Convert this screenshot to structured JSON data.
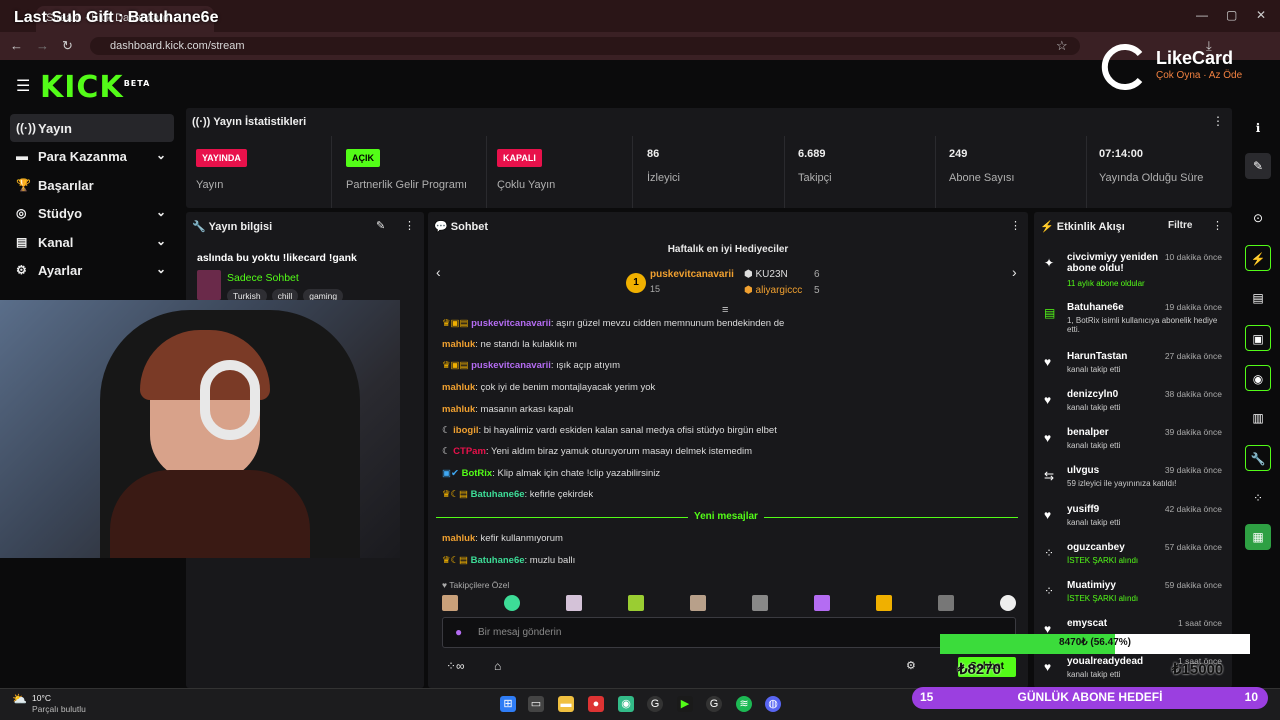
{
  "overlay": {
    "title": "Last Sub Gift : Batuhane6e"
  },
  "browser": {
    "tab_label": "Stream · Kick Dashboard",
    "url": "dashboard.kick.com/stream"
  },
  "brand": {
    "logo": "KICK",
    "beta": "BETA",
    "likecard": "LikeCard",
    "likecard_tag": "Çok Oyna · Az Öde",
    "accent": "#53fc18"
  },
  "sidebar": {
    "items": [
      {
        "label": "Yayın",
        "icon": "broadcast-icon"
      },
      {
        "label": "Para Kazanma",
        "icon": "money-icon"
      },
      {
        "label": "Başarılar",
        "icon": "trophy-icon"
      },
      {
        "label": "Stüdyo",
        "icon": "studio-icon"
      },
      {
        "label": "Kanal",
        "icon": "channel-icon"
      },
      {
        "label": "Ayarlar",
        "icon": "gear-icon"
      }
    ]
  },
  "stats": {
    "header": "Yayın İstatistikleri",
    "cells": [
      {
        "badge": "YAYINDA",
        "label": "Yayın",
        "color": "#e8114b"
      },
      {
        "badge": "AÇIK",
        "label": "Partnerlik Gelir Programı",
        "color": "#53fc18"
      },
      {
        "badge": "KAPALI",
        "label": "Çoklu Yayın",
        "color": "#e8114b"
      },
      {
        "value": "86",
        "label": "İzleyici"
      },
      {
        "value": "6.689",
        "label": "Takipçi"
      },
      {
        "value": "249",
        "label": "Abone Sayısı"
      },
      {
        "value": "07:14:00",
        "label": "Yayında Olduğu Süre"
      }
    ]
  },
  "info": {
    "header": "Yayın bilgisi",
    "title": "aslında bu yoktu !likecard !gank",
    "category": "Sadece Sohbet",
    "tags": [
      "Turkish",
      "chill",
      "gaming"
    ]
  },
  "chat": {
    "header": "Sohbet",
    "top_gifters_title": "Haftalık en iyi Hediyeciler",
    "gifters": [
      {
        "name": "puskevitcanavarii",
        "count": "15",
        "rank": "1"
      },
      {
        "name": "KU23N",
        "count": "6"
      },
      {
        "name": "aliyargiccc",
        "count": "5"
      }
    ],
    "messages": [
      {
        "user": "puskevitcanavarii",
        "text": ": aşırı güzel mevzu cidden memnunum bendekinden de",
        "color": "#b46cf2"
      },
      {
        "user": "mahluk",
        "text": ": ne standı la kulaklık mı",
        "color": "#f0a030"
      },
      {
        "user": "puskevitcanavarii",
        "text": ": ışık açıp atıyım",
        "color": "#b46cf2"
      },
      {
        "user": "mahluk",
        "text": ": çok iyi de benim montajlayacak yerim yok",
        "color": "#f0a030"
      },
      {
        "user": "mahluk",
        "text": ": masanın arkası kapalı",
        "color": "#f0a030"
      },
      {
        "user": "ibogil",
        "text": ": bi hayalimiz vardı eskiden kalan sanal medya ofisi stüdyo birgün elbet",
        "color": "#f0a030"
      },
      {
        "user": "CTPam",
        "text": ": Yeni aldım biraz yamuk oturuyorum masayı delmek istemedim",
        "color": "#e8114b"
      },
      {
        "user": "BotRix",
        "text": ": Klip almak için chate !clip yazabilirsiniz",
        "color": "#53fc18"
      },
      {
        "user": "Batuhane6e",
        "text": ": kefirle çekirdek",
        "color": "#3ddc97"
      }
    ],
    "new_messages": "Yeni mesajlar",
    "messages2": [
      {
        "user": "mahluk",
        "text": ": kefir kullanmıyorum",
        "color": "#f0a030"
      },
      {
        "user": "Batuhane6e",
        "text": ": muzlu ballı",
        "color": "#3ddc97"
      }
    ],
    "followers_only": "Takipçilere Özel",
    "input_placeholder": "Bir mesaj gönderin",
    "send_label": "Sohbet"
  },
  "events": {
    "header": "Etkinlik Akışı",
    "filter": "Filtre",
    "items": [
      {
        "name": "civcivmiyy yeniden abone oldu!",
        "time": "10 dakika önce",
        "desc": "11 aylık abone oldular",
        "icon": "sparkle-icon"
      },
      {
        "name": "Batuhane6e",
        "time": "19 dakika önce",
        "desc": "1, BotRix isimli kullanıcıya abonelik hediye etti.",
        "icon": "gift-icon"
      },
      {
        "name": "HarunTastan",
        "time": "27 dakika önce",
        "desc": "kanalı takip etti",
        "icon": "heart-icon"
      },
      {
        "name": "denizcyln0",
        "time": "38 dakika önce",
        "desc": "kanalı takip etti",
        "icon": "heart-icon"
      },
      {
        "name": "benalper",
        "time": "39 dakika önce",
        "desc": "kanalı takip etti",
        "icon": "heart-icon"
      },
      {
        "name": "ulvgus",
        "time": "39 dakika önce",
        "desc": "59 izleyici ile yayınınıza katıldı!",
        "icon": "raid-icon"
      },
      {
        "name": "yusiff9",
        "time": "42 dakika önce",
        "desc": "kanalı takip etti",
        "icon": "heart-icon"
      },
      {
        "name": "oguzcanbey",
        "time": "57 dakika önce",
        "desc": "İSTEK ŞARKI alındı",
        "icon": "points-icon"
      },
      {
        "name": "Muatimiyy",
        "time": "59 dakika önce",
        "desc": "İSTEK ŞARKI alındı",
        "icon": "points-icon"
      },
      {
        "name": "emyscat",
        "time": "1 saat önce",
        "desc": "",
        "icon": "heart-icon"
      },
      {
        "name": "youalreadydead",
        "time": "1 saat önce",
        "desc": "kanalı takip etti",
        "icon": "heart-icon"
      }
    ]
  },
  "overlays": {
    "progress_text": "8470₺ (56.47%)",
    "progress_fraction": 0.5647,
    "donation_left": "₺8270",
    "donation_right": "₺15000",
    "sub_goal_label": "GÜNLÜK ABONE HEDEFİ",
    "sub_goal_current": "15",
    "sub_goal_target": "10"
  },
  "taskbar": {
    "weather_temp": "10°C",
    "weather_desc": "Parçalı bulutlu"
  }
}
